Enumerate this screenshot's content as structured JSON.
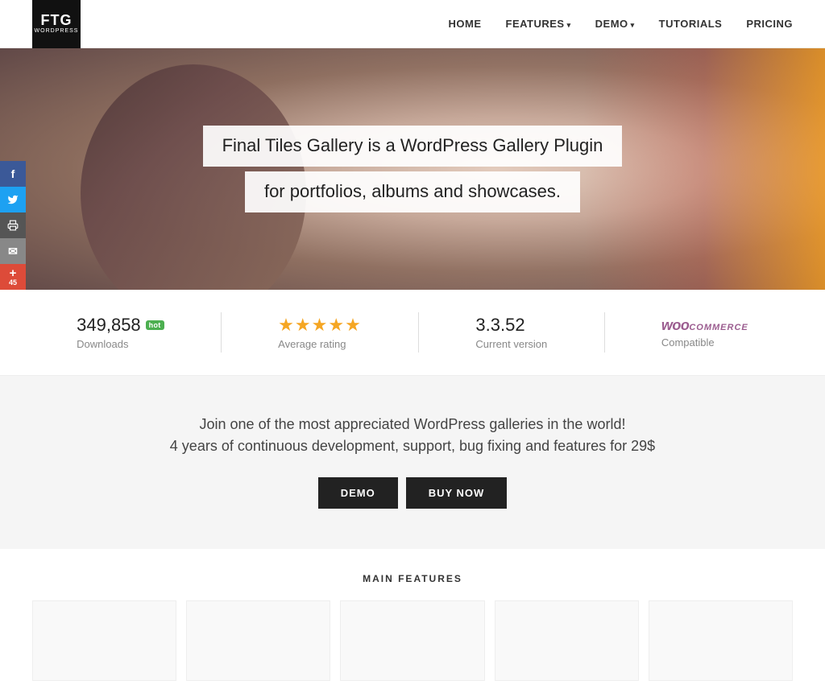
{
  "logo": {
    "ftg": "FTG",
    "wordpress": "WORDPRESS"
  },
  "nav": {
    "links": [
      {
        "label": "HOME",
        "has_dropdown": false
      },
      {
        "label": "FEATURES",
        "has_dropdown": true
      },
      {
        "label": "DEMO",
        "has_dropdown": true
      },
      {
        "label": "TUTORIALS",
        "has_dropdown": false
      },
      {
        "label": "PRICING",
        "has_dropdown": false
      }
    ]
  },
  "hero": {
    "line1": "Final Tiles Gallery is a WordPress Gallery Plugin",
    "line2": "for portfolios, albums and showcases."
  },
  "social": [
    {
      "name": "facebook",
      "symbol": "f",
      "class": "facebook"
    },
    {
      "name": "twitter",
      "symbol": "t",
      "class": "twitter"
    },
    {
      "name": "print",
      "symbol": "🖨",
      "class": "print"
    },
    {
      "name": "email",
      "symbol": "✉",
      "class": "email"
    },
    {
      "name": "plus",
      "symbol": "+",
      "count": "45",
      "class": "plus"
    }
  ],
  "stats": {
    "downloads": {
      "value": "349,858",
      "badge": "hot",
      "label": "Downloads"
    },
    "rating": {
      "stars": "★★★★★",
      "label": "Average rating"
    },
    "version": {
      "value": "3.3.52",
      "label": "Current version"
    },
    "compatible": {
      "woo": "woo",
      "commerce": "COMMERCE",
      "label": "Compatible"
    }
  },
  "cta": {
    "text1": "Join one of the most appreciated WordPress galleries in the world!",
    "text2": "4 years of continuous development, support, bug fixing and features for 29$",
    "btn_demo": "DEMO",
    "btn_buy": "BUY NOW"
  },
  "features_section": {
    "title": "MAIN FEATURES"
  }
}
